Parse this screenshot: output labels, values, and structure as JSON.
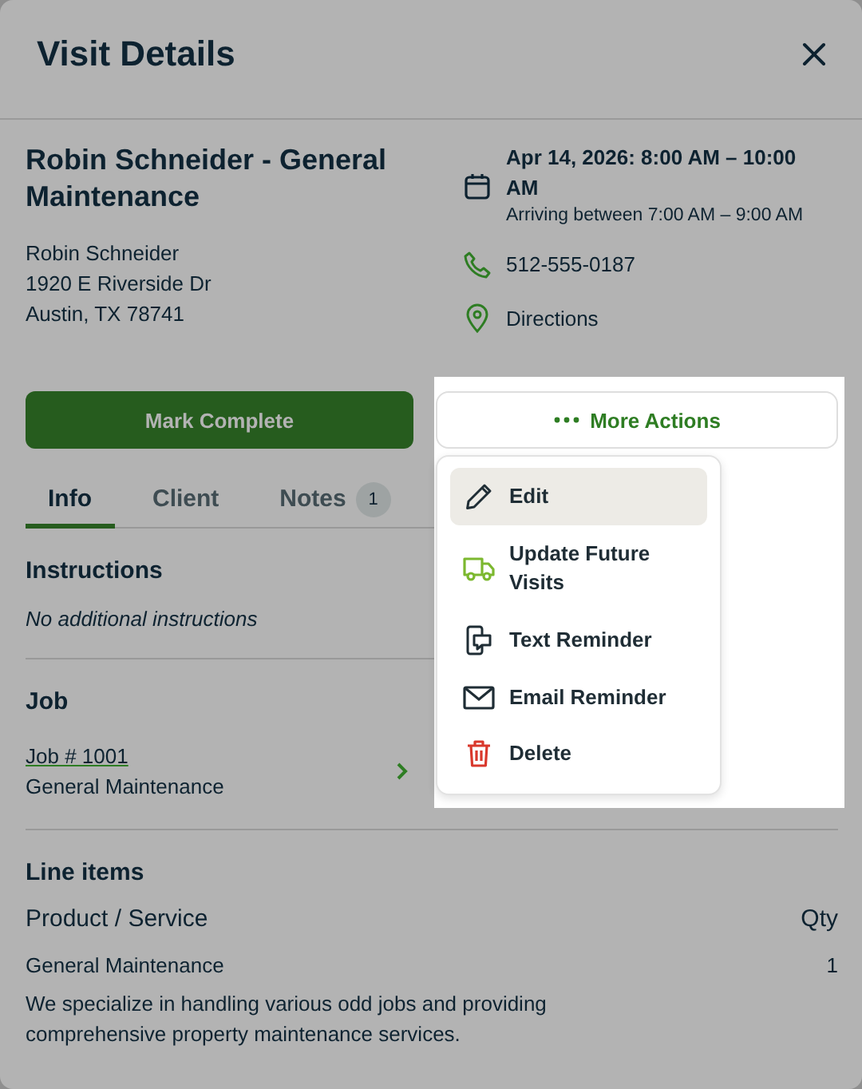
{
  "dialog": {
    "title": "Visit Details"
  },
  "visit": {
    "title": "Robin Schneider - General Maintenance",
    "client_lines": [
      "Robin Schneider",
      "1920 E Riverside Dr",
      "Austin, TX 78741"
    ],
    "schedule": "Apr 14, 2026: 8:00 AM – 10:00 AM",
    "arrival": "Arriving between 7:00 AM – 9:00 AM",
    "phone": "512-555-0187",
    "directions": "Directions"
  },
  "actions": {
    "primary": "Mark Complete",
    "more": "More Actions"
  },
  "menu": [
    {
      "label": "Edit",
      "selected": true
    },
    {
      "label": "Update Future Visits",
      "selected": false
    },
    {
      "label": "Text Reminder",
      "selected": false
    },
    {
      "label": "Email Reminder",
      "selected": false
    },
    {
      "label": "Delete",
      "selected": false
    }
  ],
  "tabs": [
    {
      "label": "Info",
      "selected": true
    },
    {
      "label": "Client",
      "selected": false
    },
    {
      "label": "Notes",
      "selected": false,
      "badge": "1"
    }
  ],
  "instructions": {
    "heading": "Instructions",
    "text": "No additional instructions"
  },
  "job": {
    "heading": "Job",
    "link": "Job # 1001",
    "subtitle": "General Maintenance"
  },
  "line_items": {
    "heading": "Line items",
    "columns": [
      "Product / Service",
      "Qty"
    ],
    "rows": [
      {
        "name": "General Maintenance",
        "qty": "1",
        "description": "We specialize in handling various odd jobs and providing comprehensive property maintenance services."
      }
    ]
  }
}
